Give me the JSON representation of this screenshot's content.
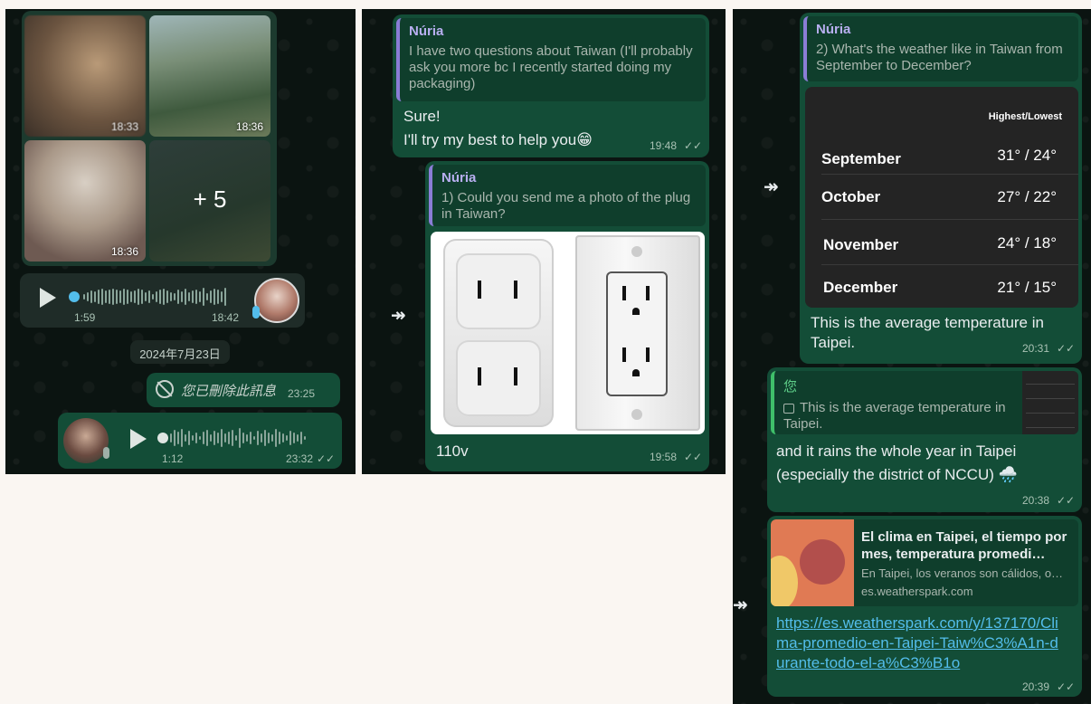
{
  "panel1": {
    "photos": [
      {
        "time": "18:33"
      },
      {
        "time": "18:36"
      },
      {
        "time": "18:36"
      },
      {
        "more": "+ 5"
      }
    ],
    "voice1": {
      "duration": "1:59",
      "time": "18:42"
    },
    "date_chip": "2024年7月23日",
    "deleted": {
      "text": "您已刪除此訊息",
      "time": "23:25"
    },
    "voice2": {
      "duration": "1:12",
      "time": "23:32"
    }
  },
  "panel2": {
    "msg1": {
      "quote_name": "Núria",
      "quote_text": "I have two questions about Taiwan (I'll probably ask you more bc I recently started doing my packaging)",
      "line1": "Sure!",
      "line2": "I'll try my best to help you😁",
      "time": "19:48"
    },
    "msg2": {
      "quote_name": "Núria",
      "quote_text": "1) Could you send me a photo of the plug in Taiwan?",
      "caption": "110v",
      "time": "19:58"
    }
  },
  "panel3": {
    "msg1": {
      "quote_name": "Núria",
      "quote_text": "2) What's the weather like in Taiwan from September to December?",
      "table_header": "Highest/Lowest",
      "rows": [
        {
          "month": "September",
          "temp": "31° / 24°"
        },
        {
          "month": "October",
          "temp": "27° / 22°"
        },
        {
          "month": "November",
          "temp": "24° / 18°"
        },
        {
          "month": "December",
          "temp": "21° / 15°"
        }
      ],
      "text": "This is the average temperature in Taipei.",
      "time": "20:31"
    },
    "msg2": {
      "quote_name": "您",
      "quote_text": "This is the average temperature in Taipei.",
      "text": "and it rains the whole year in Taipei (especially the district of NCCU) 🌧️",
      "time": "20:38"
    },
    "msg3": {
      "link_title": "El clima en Taipei, el tiempo por mes, temperatura promedi…",
      "link_desc": "En Taipei, los veranos son cálidos, o…",
      "link_domain": "es.weatherspark.com",
      "url": "https://es.weatherspark.com/y/137170/Clima-promedio-en-Taipei-Taiw%C3%A1n-durante-todo-el-a%C3%B1o",
      "time": "20:39"
    }
  },
  "ticks": "✓✓",
  "forward_glyph": "↠"
}
